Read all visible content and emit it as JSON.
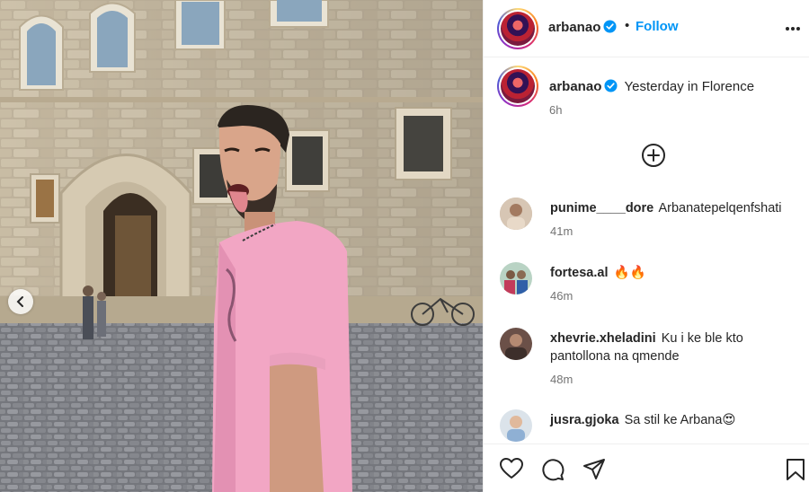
{
  "post": {
    "username": "arbanao",
    "follow_label": "Follow",
    "separator": "•",
    "caption": "Yesterday in Florence",
    "caption_time": "6h"
  },
  "comments": [
    {
      "username": "punime____dore",
      "text": "Arbanatepelqenfshati",
      "time": "41m"
    },
    {
      "username": "fortesa.al",
      "text": "🔥🔥",
      "time": "46m"
    },
    {
      "username": "xhevrie.xheladini",
      "text": "Ku i ke ble kto pantollona na qmende",
      "time": "48m"
    },
    {
      "username": "jusra.gjoka",
      "text": "Sa stil ke Arbana😍",
      "time": ""
    }
  ],
  "icons": {
    "more": "more-options-icon",
    "verified": "verified-badge-icon",
    "load_more": "plus-circle-icon",
    "like": "heart-icon",
    "comment": "comment-icon",
    "share": "paper-plane-icon",
    "save": "bookmark-icon",
    "carousel": "chevron-left-icon"
  },
  "colors": {
    "accent": "#0095f6",
    "text": "#262626",
    "muted": "#737373",
    "shirt": "#f2a6c4"
  }
}
